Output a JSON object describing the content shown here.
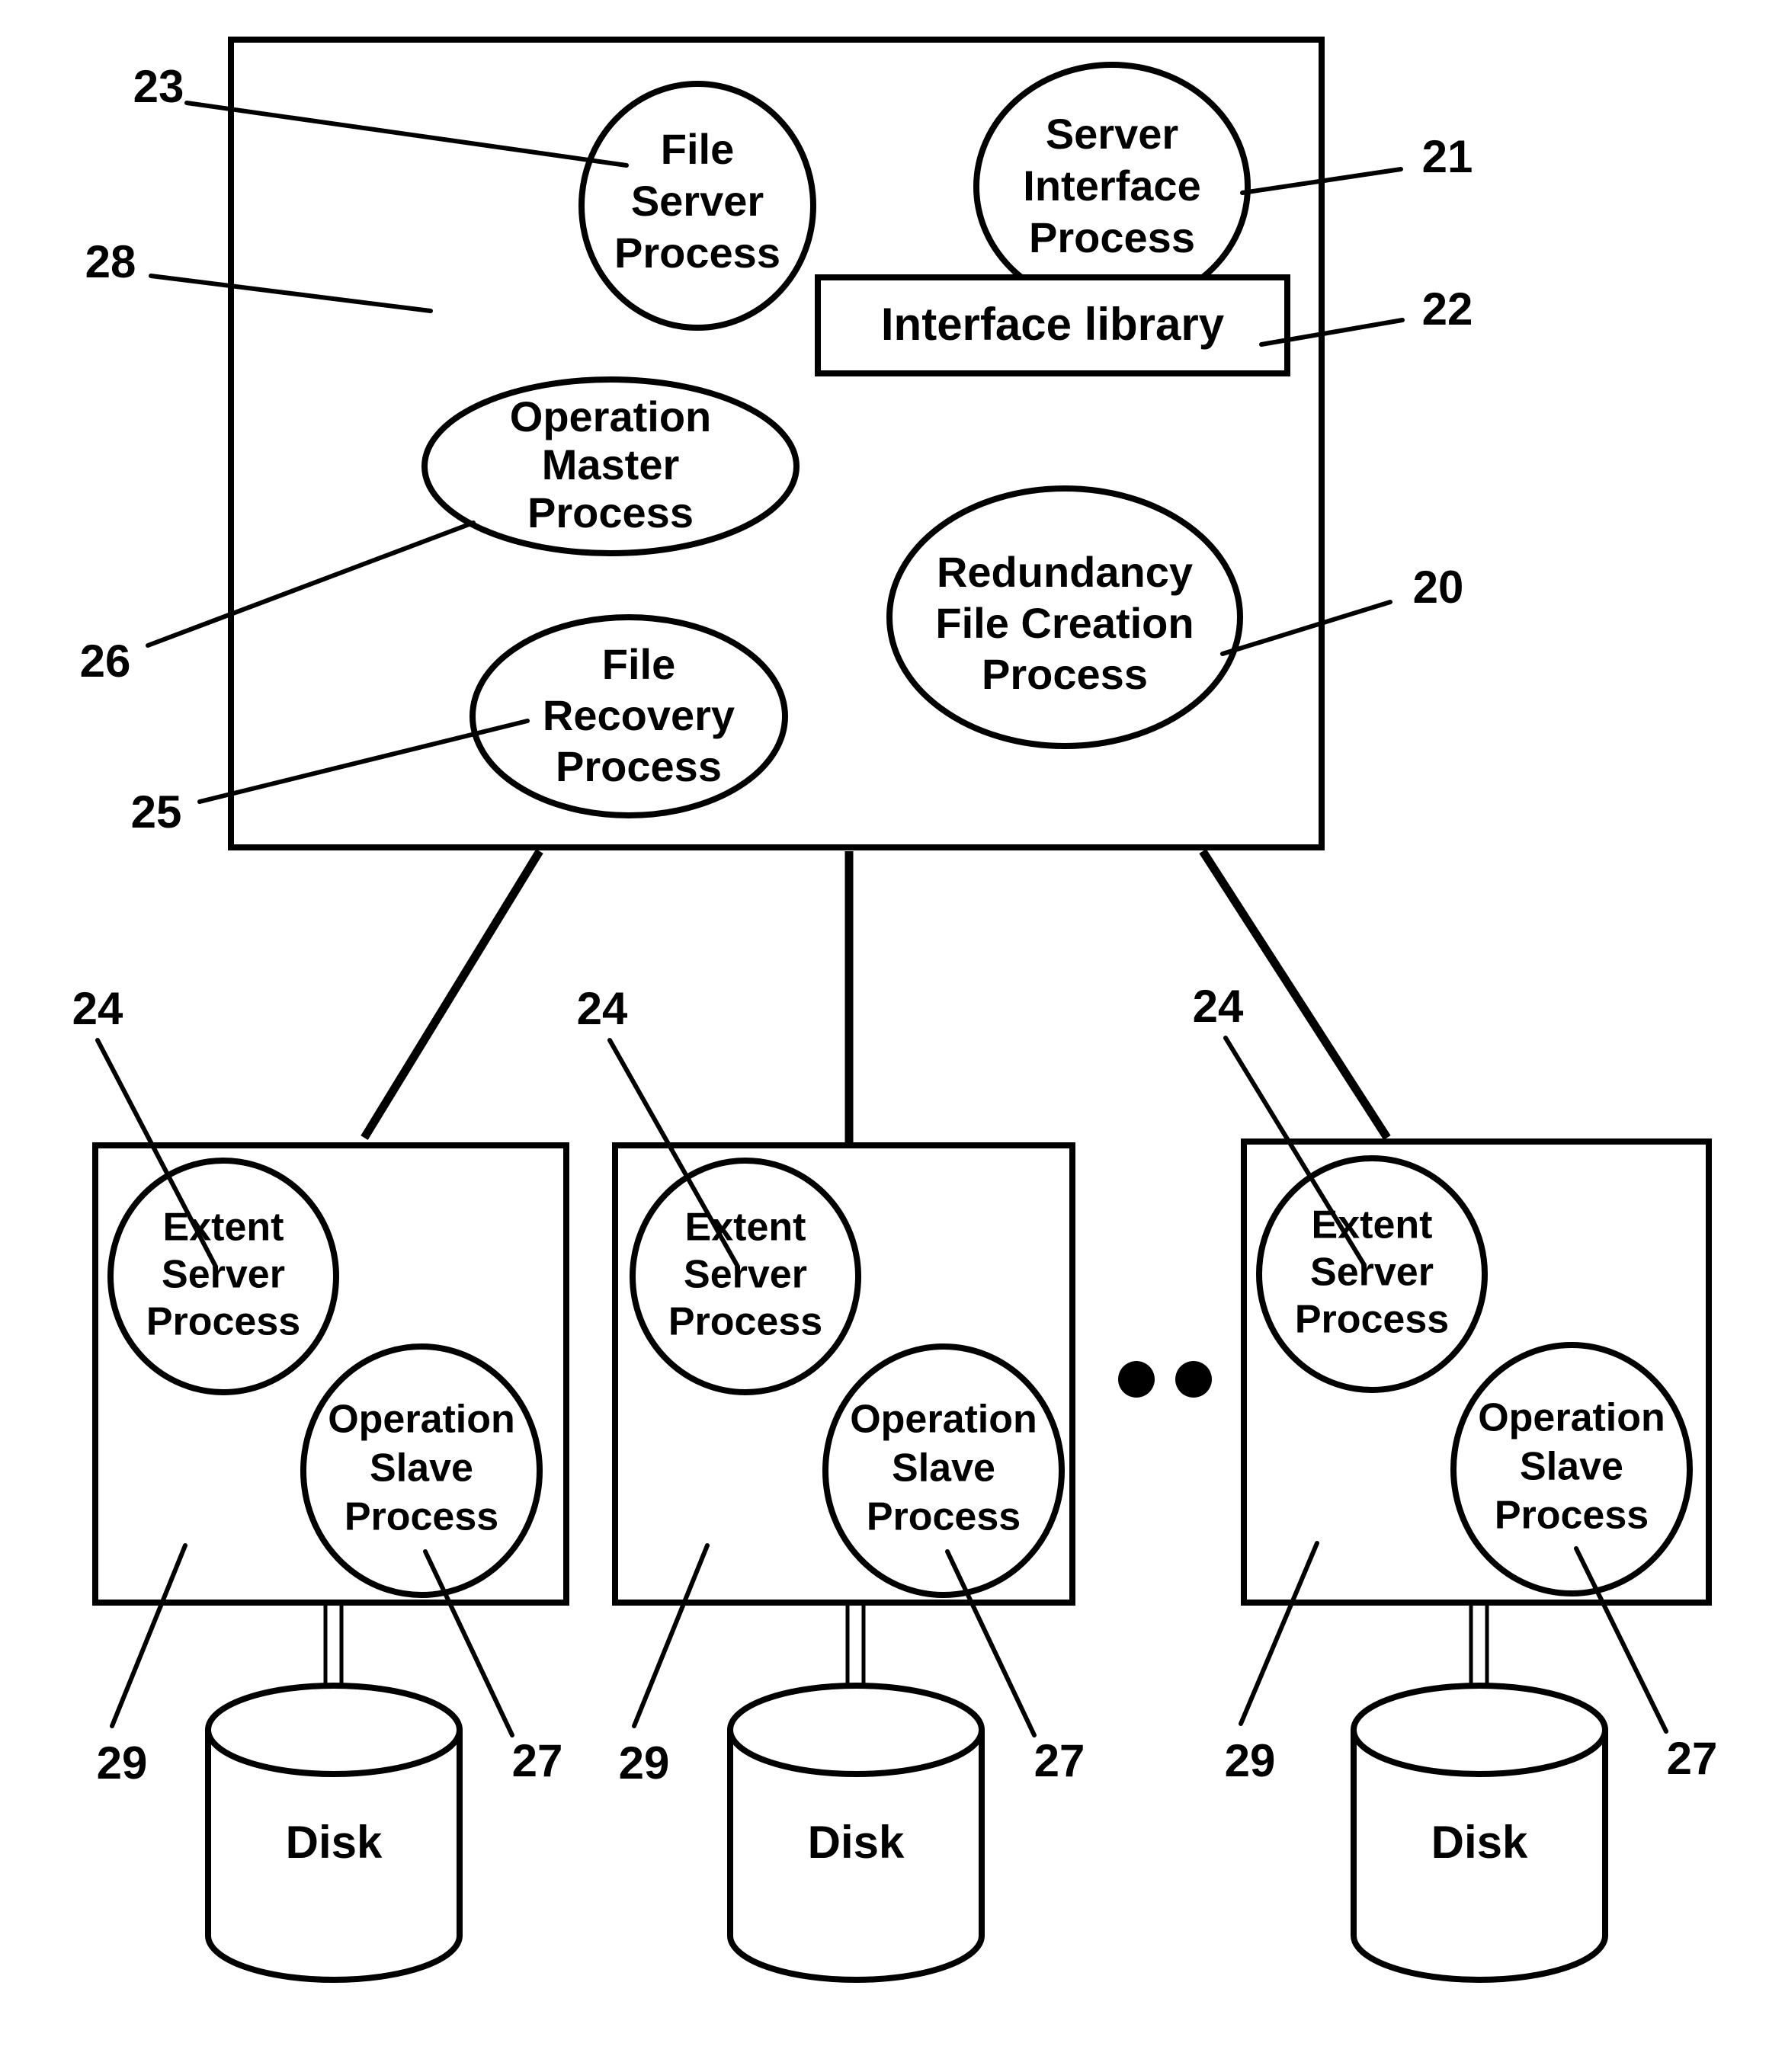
{
  "figure": {
    "kind": "patent-figure",
    "background_color": "#ffffff",
    "line_color": "#000000"
  },
  "server_box": {
    "name": "main-server-box",
    "ref": "28",
    "nodes": {
      "file_server_process": {
        "lines": [
          "File",
          "Server",
          "Process"
        ],
        "ref": "23"
      },
      "server_interface_process": {
        "lines": [
          "Server",
          "Interface",
          "Process"
        ],
        "ref": "21"
      },
      "interface_library": {
        "label": "Interface library",
        "ref": "22"
      },
      "operation_master_process": {
        "lines": [
          "Operation",
          "Master",
          "Process"
        ],
        "ref": "26"
      },
      "file_recovery_process": {
        "lines": [
          "File",
          "Recovery",
          "Process"
        ],
        "ref": "25"
      },
      "redundancy_file_creation_process": {
        "lines": [
          "Redundancy",
          "File Creation",
          "Process"
        ],
        "ref": "20"
      }
    }
  },
  "extent_nodes": [
    {
      "box_ref": "29",
      "extent_server_ref": "24",
      "operation_slave_ref": "27",
      "extent_server_lines": [
        "Extent",
        "Server",
        "Process"
      ],
      "operation_slave_lines": [
        "Operation",
        "Slave",
        "Process"
      ],
      "disk_label": "Disk"
    },
    {
      "box_ref": "29",
      "extent_server_ref": "24",
      "operation_slave_ref": "27",
      "extent_server_lines": [
        "Extent",
        "Server",
        "Process"
      ],
      "operation_slave_lines": [
        "Operation",
        "Slave",
        "Process"
      ],
      "disk_label": "Disk"
    },
    {
      "box_ref": "29",
      "extent_server_ref": "24",
      "operation_slave_ref": "27",
      "extent_server_lines": [
        "Extent",
        "Server",
        "Process"
      ],
      "operation_slave_lines": [
        "Operation",
        "Slave",
        "Process"
      ],
      "disk_label": "Disk"
    }
  ],
  "ellipsis": {
    "name": "continuation-dots",
    "count": 2
  }
}
